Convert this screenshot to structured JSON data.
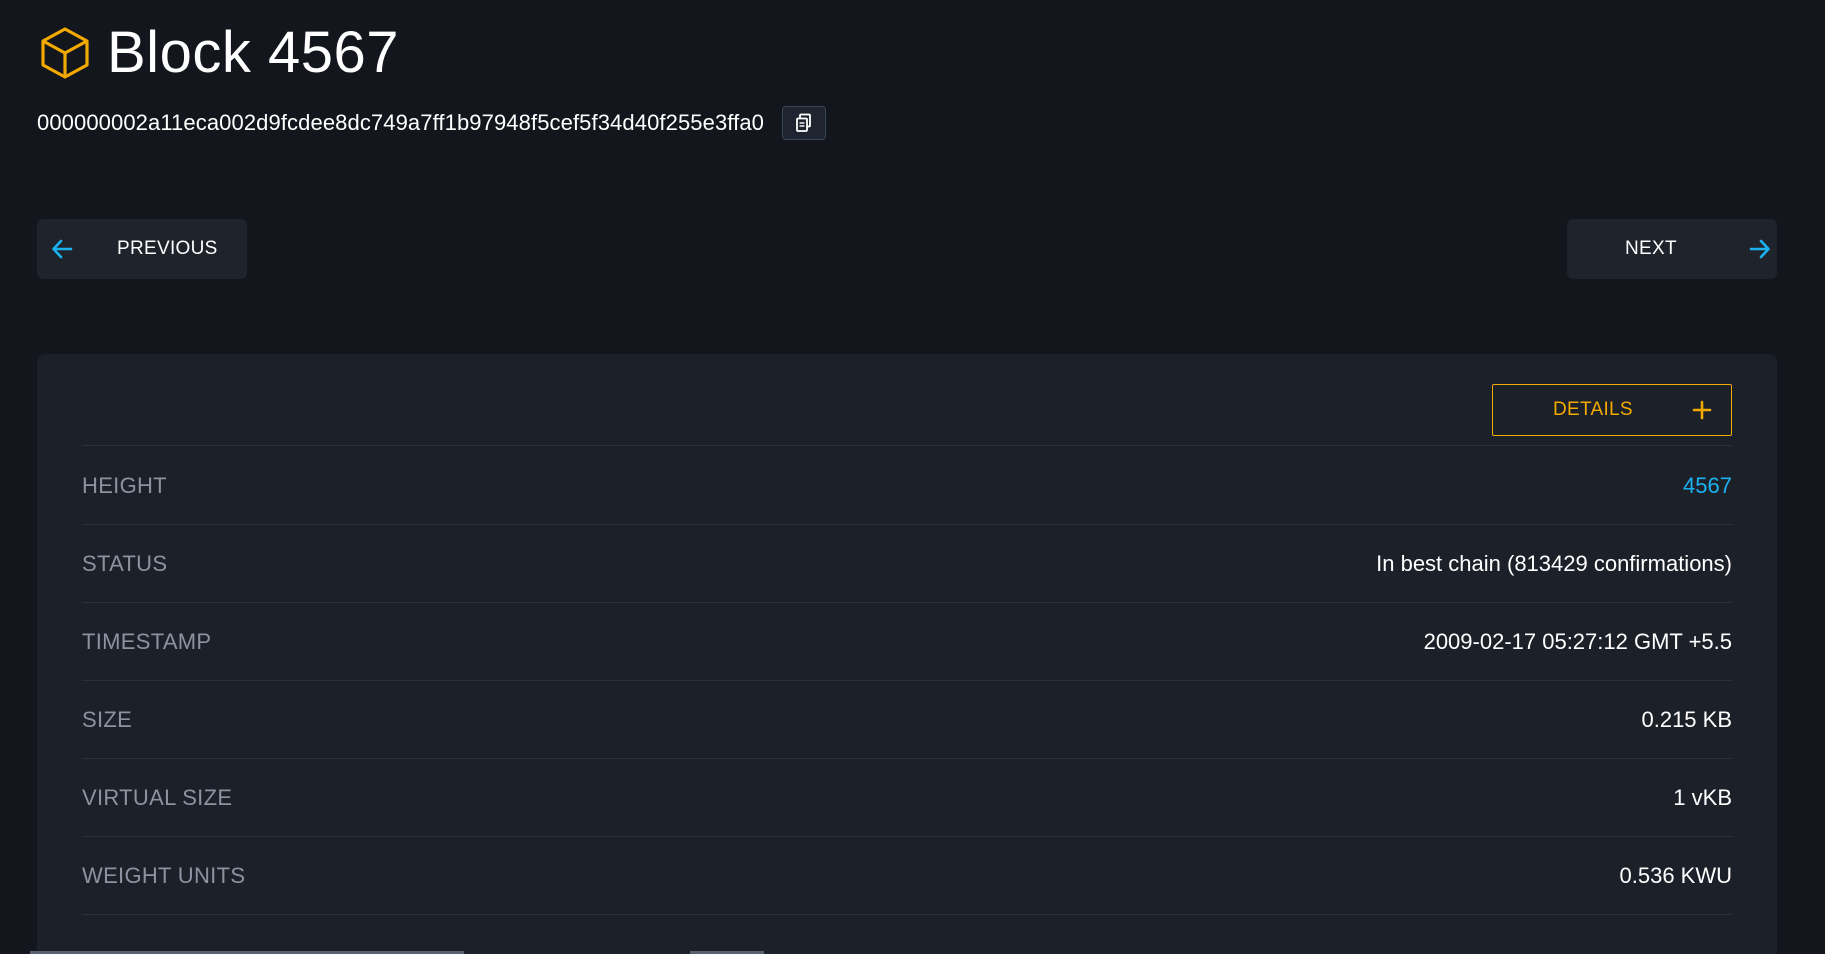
{
  "header": {
    "title": "Block 4567",
    "icon": "cube-icon",
    "accent_color": "#f2a900"
  },
  "block_hash": "000000002a11eca002d9fcdee8dc749a7ff1b97948f5cef5f34d40f255e3ffa0",
  "copy_button": {
    "icon": "copy-icon"
  },
  "nav": {
    "previous_label": "PREVIOUS",
    "next_label": "NEXT",
    "arrow_color": "#1bb2f0"
  },
  "details_button": {
    "label": "DETAILS",
    "icon": "plus-icon"
  },
  "rows": [
    {
      "label": "HEIGHT",
      "value": "4567",
      "link": true
    },
    {
      "label": "STATUS",
      "value": "In best chain (813429 confirmations)"
    },
    {
      "label": "TIMESTAMP",
      "value": "2009-02-17 05:27:12 GMT +5.5"
    },
    {
      "label": "SIZE",
      "value": "0.215 KB"
    },
    {
      "label": "VIRTUAL SIZE",
      "value": "1 vKB"
    },
    {
      "label": "WEIGHT UNITS",
      "value": "0.536 KWU"
    }
  ]
}
